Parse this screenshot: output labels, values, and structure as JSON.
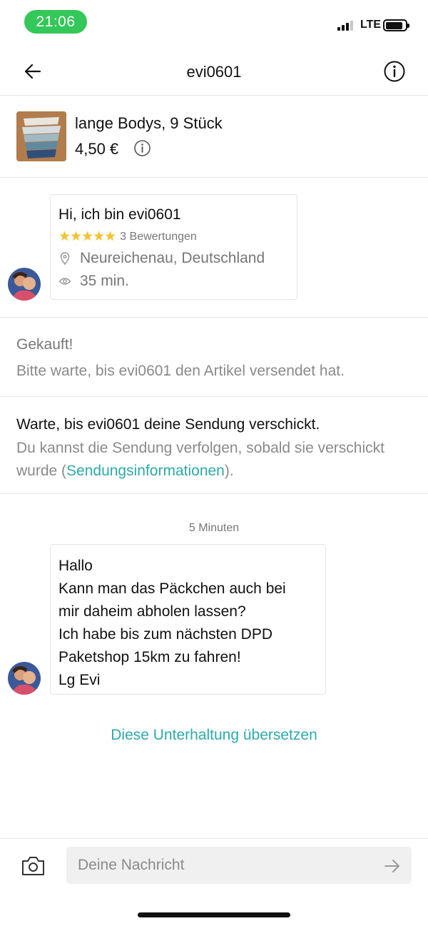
{
  "status_bar": {
    "time": "21:06",
    "network": "LTE",
    "icons": [
      "signal-icon",
      "battery-icon"
    ]
  },
  "nav": {
    "title": "evi0601",
    "icons": [
      "back-arrow-icon",
      "info-icon"
    ]
  },
  "item": {
    "title": "lange Bodys, 9 Stück",
    "price": "4,50 €",
    "icons": [
      "item-thumbnail",
      "price-info-icon"
    ]
  },
  "profile": {
    "greeting": "Hi, ich bin evi0601",
    "stars": "★★★★★",
    "rating_value": 5,
    "rating_count": "3 Bewertungen",
    "location": "Neureichenau, Deutschland",
    "last_seen": "35 min.",
    "icons": [
      "location-pin-icon",
      "eye-icon"
    ]
  },
  "status": {
    "title": "Gekauft!",
    "text": "Bitte warte, bis evi0601 den Artikel versendet hat."
  },
  "shipping": {
    "title": "Warte, bis evi0601 deine Sendung verschickt.",
    "text_before": "Du kannst die Sendung verfolgen, sobald sie verschickt wurde (",
    "link": "Sendungsinformationen",
    "text_after": ")."
  },
  "chat": {
    "timestamp": "5 Minuten",
    "message_lines": [
      "Hallo",
      "Kann man das Päckchen auch bei",
      "mir daheim abholen lassen?",
      "Ich habe bis zum nächsten DPD",
      "Paketshop 15km zu fahren!",
      "Lg Evi"
    ]
  },
  "translate_link": "Diese Unterhaltung übersetzen",
  "composer": {
    "placeholder": "Deine Nachricht",
    "icons": [
      "camera-icon",
      "send-arrow-icon"
    ]
  },
  "colors": {
    "accent": "#2ea9a9",
    "time_pill": "#34c759",
    "stars": "#f2c230",
    "divider": "#e6e6e6"
  }
}
